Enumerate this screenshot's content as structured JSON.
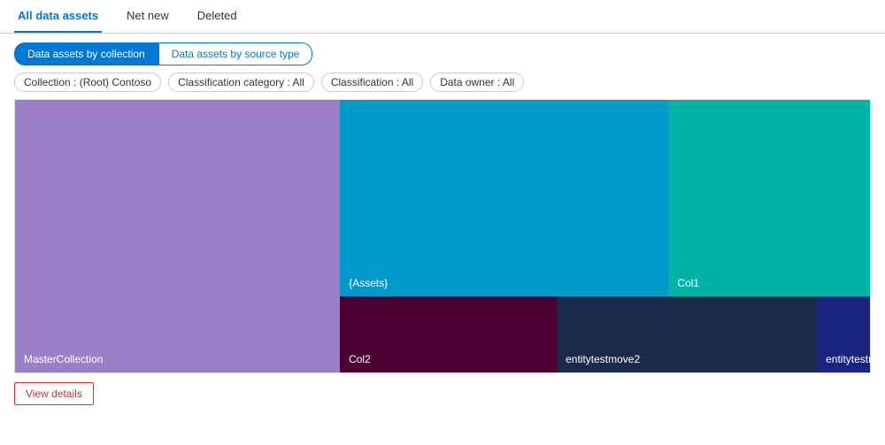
{
  "tabs": {
    "items": [
      {
        "label": "All data assets",
        "active": true
      },
      {
        "label": "Net new",
        "active": false
      },
      {
        "label": "Deleted",
        "active": false
      }
    ]
  },
  "viewToggle": {
    "option1": "Data assets by collection",
    "option2": "Data assets by source type"
  },
  "filters": {
    "chips": [
      {
        "label": "Collection : (Root) Contoso"
      },
      {
        "label": "Classification category : All"
      },
      {
        "label": "Classification : All"
      },
      {
        "label": "Data owner : All"
      }
    ]
  },
  "treemap": {
    "blocks": [
      {
        "name": "MasterCollection",
        "color": "#9b7fc7"
      },
      {
        "name": "{Assets}",
        "color": "#0099cc"
      },
      {
        "name": "Col1",
        "color": "#00b3a4"
      },
      {
        "name": "Col2",
        "color": "#4a0030"
      },
      {
        "name": "entitytestmove2",
        "color": "#1a2a4a"
      },
      {
        "name": "entitytestmov...",
        "color": "#1a237e"
      }
    ]
  },
  "viewDetails": {
    "label": "View details"
  }
}
